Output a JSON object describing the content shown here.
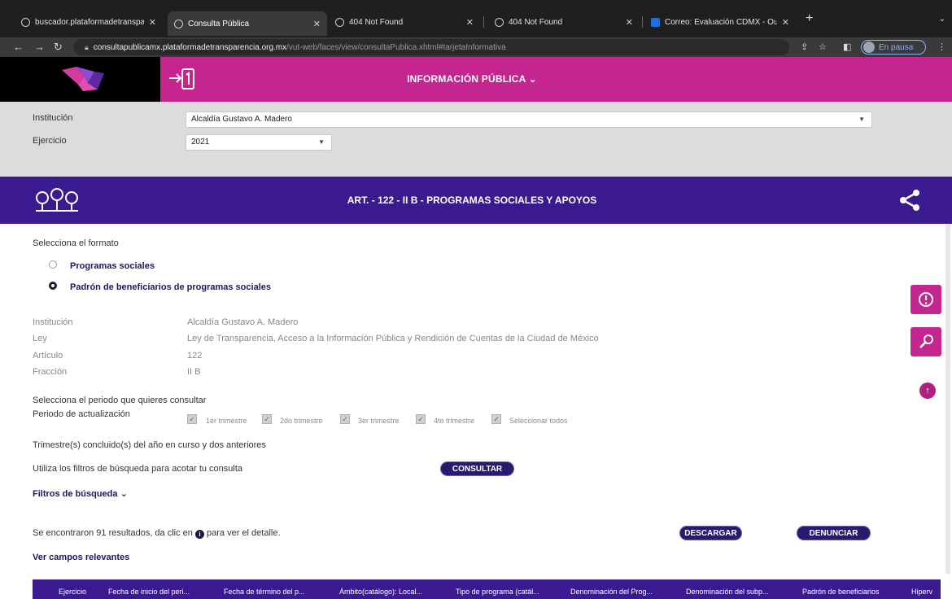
{
  "browser": {
    "tabs": [
      {
        "title": "buscador.plataformadetranspa",
        "active": false
      },
      {
        "title": "Consulta Pública",
        "active": true
      },
      {
        "title": "404 Not Found",
        "active": false
      },
      {
        "title": "404 Not Found",
        "active": false
      },
      {
        "title": "Correo: Evaluación CDMX - Ou",
        "active": false
      }
    ],
    "url_host": "consultapublicamx.plataformadetransparencia.org.mx",
    "url_path": "/vut-web/faces/view/consultaPublica.xhtml#tarjetaInformativa",
    "profile_label": "En pausa"
  },
  "header": {
    "title": "INFORMACIÓN PÚBLICA",
    "brand_color": "#c4258e"
  },
  "filters": {
    "institucion_label": "Institución",
    "institucion_value": "Alcaldía Gustavo A. Madero",
    "ejercicio_label": "Ejercicio",
    "ejercicio_value": "2021"
  },
  "band": {
    "title": "ART. - 122 - II B - PROGRAMAS SOCIALES Y APOYOS",
    "color": "#3a1a8e"
  },
  "format": {
    "prompt": "Selecciona el formato",
    "options": [
      {
        "label": "Programas sociales",
        "selected": false
      },
      {
        "label": "Padrón de beneficiarios de programas sociales",
        "selected": true
      }
    ]
  },
  "info": {
    "rows": [
      {
        "label": "Institución",
        "value": "Alcaldía Gustavo A. Madero"
      },
      {
        "label": "Ley",
        "value": "Ley de Transparencia, Acceso a la Información Pública y Rendición de Cuentas de la Ciudad de México"
      },
      {
        "label": "Artículo",
        "value": "122"
      },
      {
        "label": "Fracción",
        "value": "II B"
      }
    ]
  },
  "period": {
    "prompt": "Selecciona el periodo que quieres consultar",
    "label": "Periodo de actualización",
    "options": [
      {
        "label": "1er trimestre",
        "checked": true
      },
      {
        "label": "2do trimestre",
        "checked": true
      },
      {
        "label": "3er trimestre",
        "checked": true
      },
      {
        "label": "4to trimestre",
        "checked": true
      },
      {
        "label": "Seleccionar todos",
        "checked": true
      }
    ],
    "note": "Trimestre(s) concluido(s) del año en curso y dos anteriores"
  },
  "search": {
    "hint": "Utiliza los filtros de búsqueda para acotar tu consulta",
    "consultar_label": "CONSULTAR",
    "filters_toggle": "Filtros de búsqueda"
  },
  "results": {
    "text_before": "Se encontraron 91 resultados, da clic en",
    "text_after": "para ver el detalle.",
    "descargar_label": "DESCARGAR",
    "denunciar_label": "DENUNCIAR",
    "campos_link": "Ver campos relevantes"
  },
  "table": {
    "columns": [
      "Ejercicio",
      "Fecha de inicio del peri...",
      "Fecha de término del p...",
      "Ámbito(catálogo): Local...",
      "Tipo de programa (catál...",
      "Denominación del Prog...",
      "Denominación del subp...",
      "Padrón de beneficiarios",
      "Hiperv"
    ]
  }
}
